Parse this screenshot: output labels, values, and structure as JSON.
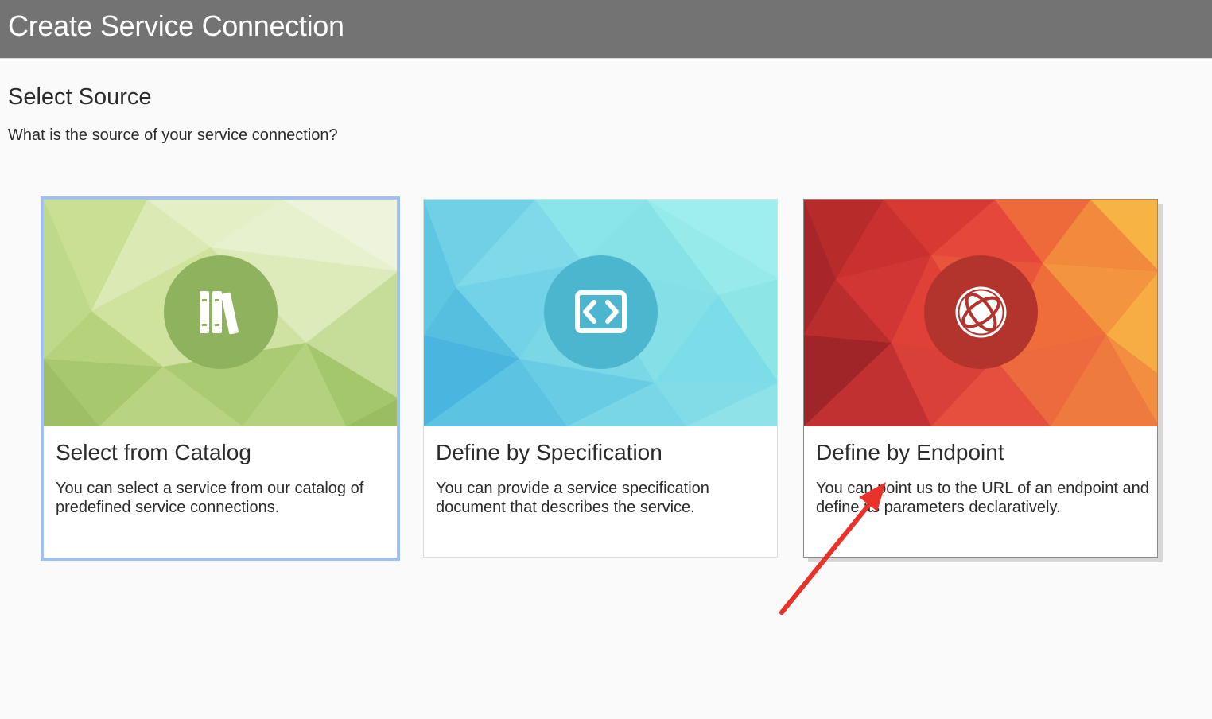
{
  "header": {
    "title": "Create Service Connection"
  },
  "main": {
    "title": "Select Source",
    "subtitle": "What is the source of your service connection?"
  },
  "cards": [
    {
      "title": "Select from Catalog",
      "description": "You can select a service from our catalog of predefined service connections.",
      "icon": "books-icon",
      "state": "selected"
    },
    {
      "title": "Define by Specification",
      "description": "You can provide a service specification document that describes the service.",
      "icon": "code-brackets-icon",
      "state": "default"
    },
    {
      "title": "Define by Endpoint",
      "description": "You can point us to the URL of an endpoint and define its parameters declaratively.",
      "icon": "globe-orbit-icon",
      "state": "hovered"
    }
  ],
  "annotation": {
    "type": "arrow",
    "color": "#e8322a",
    "points_to": "Define by Endpoint"
  },
  "colors": {
    "header_bg": "#737373",
    "selected_border": "#9cc0f5",
    "catalog_accent": "#8fb25f",
    "spec_accent": "#4db6cf",
    "endpoint_accent": "#b3342c"
  }
}
